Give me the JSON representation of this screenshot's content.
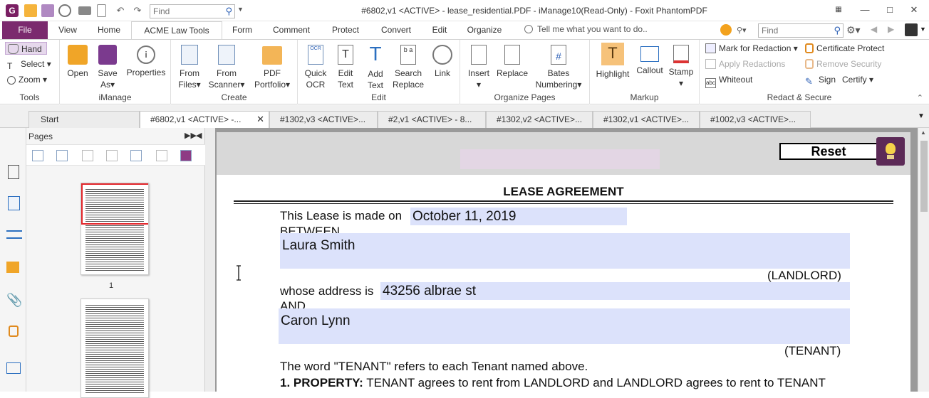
{
  "window": {
    "title": "#6802,v1 <ACTIVE> - lease_residential.PDF  - iManage10(Read-Only) - Foxit PhantomPDF",
    "find_placeholder": "Find"
  },
  "tabs": {
    "file": "File",
    "items": [
      "View",
      "Home",
      "ACME Law Tools",
      "Form",
      "Comment",
      "Protect",
      "Convert",
      "Edit",
      "Organize"
    ],
    "active": "ACME Law Tools",
    "tell_me": "Tell me what you want to do..",
    "find_placeholder": "Find"
  },
  "ribbon": {
    "tools": {
      "label": "Tools",
      "hand": "Hand",
      "select": "Select",
      "zoom": "Zoom"
    },
    "imanage": {
      "label": "iManage",
      "open": "Open",
      "save_as_1": "Save",
      "save_as_2": "As",
      "properties": "Properties"
    },
    "create": {
      "label": "Create",
      "from_files_1": "From",
      "from_files_2": "Files",
      "from_scanner_1": "From",
      "from_scanner_2": "Scanner",
      "pdf_portfolio_1": "PDF",
      "pdf_portfolio_2": "Portfolio"
    },
    "edit": {
      "label": "Edit",
      "quick_ocr_1": "Quick",
      "quick_ocr_2": "OCR",
      "edit_text_1": "Edit",
      "edit_text_2": "Text",
      "add_text_1": "Add",
      "add_text_2": "Text",
      "search_replace_1": "Search",
      "search_replace_2": "Replace",
      "link": "Link"
    },
    "organize": {
      "label": "Organize Pages",
      "insert": "Insert",
      "replace": "Replace",
      "bates_1": "Bates",
      "bates_2": "Numbering"
    },
    "markup": {
      "label": "Markup",
      "highlight": "Highlight",
      "callout": "Callout",
      "stamp": "Stamp"
    },
    "redact": {
      "label": "Redact & Secure",
      "mark": "Mark for Redaction",
      "apply": "Apply Redactions",
      "whiteout": "Whiteout",
      "cert": "Certificate Protect",
      "remove": "Remove Security",
      "sign": "Sign",
      "certify": "Certify"
    }
  },
  "doc_tabs": [
    {
      "label": "Start"
    },
    {
      "label": "#6802,v1 <ACTIVE> -...",
      "active": true
    },
    {
      "label": "#1302,v3 <ACTIVE>..."
    },
    {
      "label": "#2,v1 <ACTIVE> - 8..."
    },
    {
      "label": "#1302,v2 <ACTIVE>..."
    },
    {
      "label": "#1302,v1 <ACTIVE>..."
    },
    {
      "label": "#1002,v3 <ACTIVE>..."
    }
  ],
  "pages_panel": {
    "title": "Pages",
    "page1_number": "1"
  },
  "document": {
    "reset": "Reset",
    "title": "LEASE AGREEMENT",
    "made_on_label": "This Lease is made on",
    "made_on_value": "October 11, 2019",
    "between": "BETWEEN",
    "landlord_name": "Laura Smith",
    "landlord_role": "(LANDLORD)",
    "address_label": "whose address is",
    "address_value": "43256 albrae st",
    "and": "AND",
    "tenant_name": "Caron Lynn",
    "tenant_role": "(TENANT)",
    "tenant_def": "The word \"TENANT\" refers to each Tenant named above.",
    "property_heading": "1. PROPERTY:",
    "property_text": "TENANT agrees to rent from LANDLORD and LANDLORD agrees to rent to TENANT"
  },
  "colors": {
    "accent": "#7b2a6e",
    "field_bg": "#dce2fb",
    "selection": "#e3262b"
  }
}
